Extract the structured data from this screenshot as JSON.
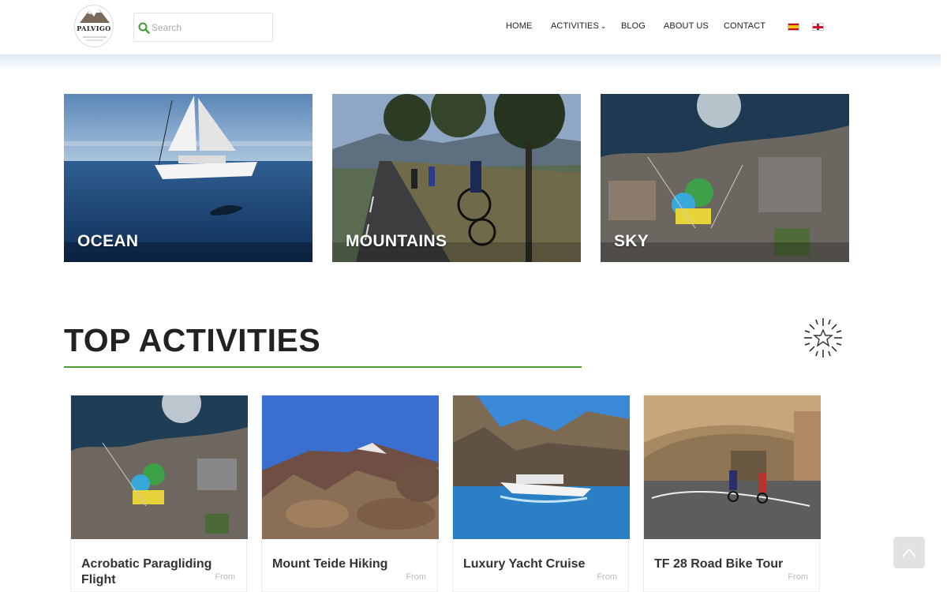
{
  "header": {
    "logo_text": "PALVIGO",
    "search": {
      "placeholder": "Search",
      "value": ""
    },
    "nav": [
      {
        "label": "HOME"
      },
      {
        "label": "ACTIVITIES"
      },
      {
        "label": "BLOG"
      },
      {
        "label": "ABOUT US"
      },
      {
        "label": "CONTACT"
      }
    ],
    "languages": [
      "es-flag-icon",
      "gb-flag-icon"
    ]
  },
  "categories": [
    {
      "label": "OCEAN"
    },
    {
      "label": "MOUNTAINS"
    },
    {
      "label": "SKY"
    }
  ],
  "top_activities": {
    "title": "TOP ACTIVITIES",
    "icon": "sparkle-star-icon",
    "accent_color": "#4a9d32",
    "cards": [
      {
        "title": "Acrobatic Paragliding Flight",
        "price_prefix": "From"
      },
      {
        "title": "Mount Teide Hiking",
        "price_prefix": "From"
      },
      {
        "title": "Luxury Yacht Cruise",
        "price_prefix": "From"
      },
      {
        "title": "TF 28 Road Bike Tour",
        "price_prefix": "From"
      }
    ]
  },
  "scroll_top": {
    "icon": "chevron-up-icon"
  }
}
